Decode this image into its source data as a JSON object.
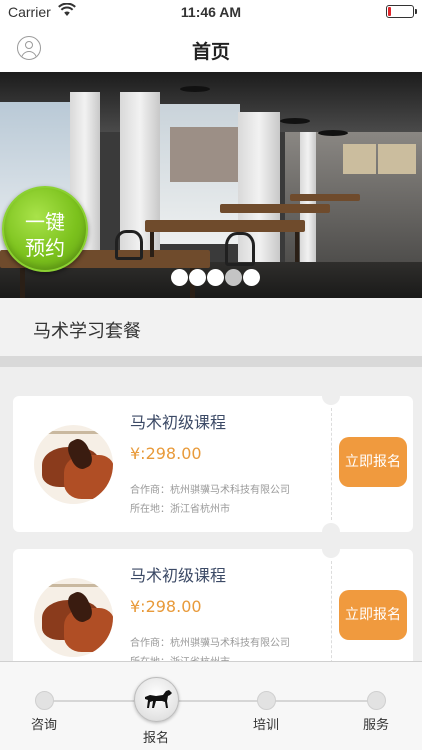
{
  "status_bar": {
    "carrier": "Carrier",
    "time": "11:46 AM",
    "battery_color": "#e0242a"
  },
  "nav": {
    "title": "首页",
    "left_icon": "user-profile-icon"
  },
  "banner": {
    "quick_book_line1": "一键",
    "quick_book_line2": "预约",
    "quick_book_color": "#7cc21d",
    "dots_total": 5,
    "dots_active_index": 3
  },
  "section": {
    "title": "马术学习套餐"
  },
  "courses": [
    {
      "name": "马术初级课程",
      "price": "¥:298.00",
      "partner": "合作商：杭州骐骥马术科技有限公司",
      "location": "所在地：浙江省杭州市",
      "button": "立即报名"
    },
    {
      "name": "马术初级课程",
      "price": "¥:298.00",
      "partner": "合作商：杭州骐骥马术科技有限公司",
      "location": "所在地：浙江省杭州市",
      "button": "立即报名"
    }
  ],
  "tabs": [
    {
      "label": "咨询",
      "active": false
    },
    {
      "label": "报名",
      "active": true,
      "icon": "horse-icon"
    },
    {
      "label": "培训",
      "active": false
    },
    {
      "label": "服务",
      "active": false
    }
  ],
  "colors": {
    "accent_orange": "#f09a3e",
    "price_orange": "#e89a3a",
    "course_title": "#3c4a66"
  }
}
